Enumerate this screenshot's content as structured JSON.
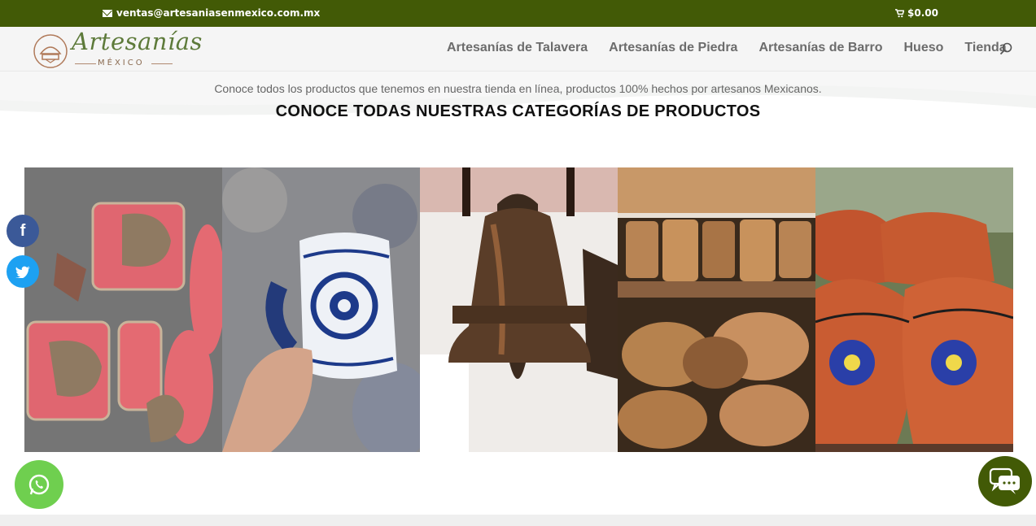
{
  "topbar": {
    "email": "ventas@artesaniasenmexico.com.mx",
    "cart_total": "$0.00",
    "email_icon": "envelope-icon",
    "cart_icon": "shopping-cart-icon"
  },
  "header": {
    "logo_word": "Artesanías",
    "logo_sub": "MÉXICO",
    "nav": [
      {
        "label": "Artesanías de Talavera"
      },
      {
        "label": "Artesanías de Piedra"
      },
      {
        "label": "Artesanías de Barro"
      },
      {
        "label": "Hueso"
      },
      {
        "label": "Tienda"
      }
    ],
    "search_icon": "search-icon"
  },
  "content": {
    "intro": "Conoce todos los productos que tenemos en nuestra tienda en línea, productos 100% hechos  por artesanos Mexicanos.",
    "heading": "CONOCE TODAS NUESTRAS CATEGORÍAS DE PRODUCTOS"
  },
  "gallery": [
    {
      "name": "leather-goods-image"
    },
    {
      "name": "talavera-mug-image"
    },
    {
      "name": "bronze-bell-image"
    },
    {
      "name": "wooden-crafts-image"
    },
    {
      "name": "clay-pitchers-image"
    }
  ],
  "social": {
    "facebook": "f",
    "twitter": "t"
  },
  "colors": {
    "topbar": "#425a06",
    "nav_text": "#6c6c6c",
    "whatsapp": "#6fcf4f",
    "chat": "#425a06"
  }
}
